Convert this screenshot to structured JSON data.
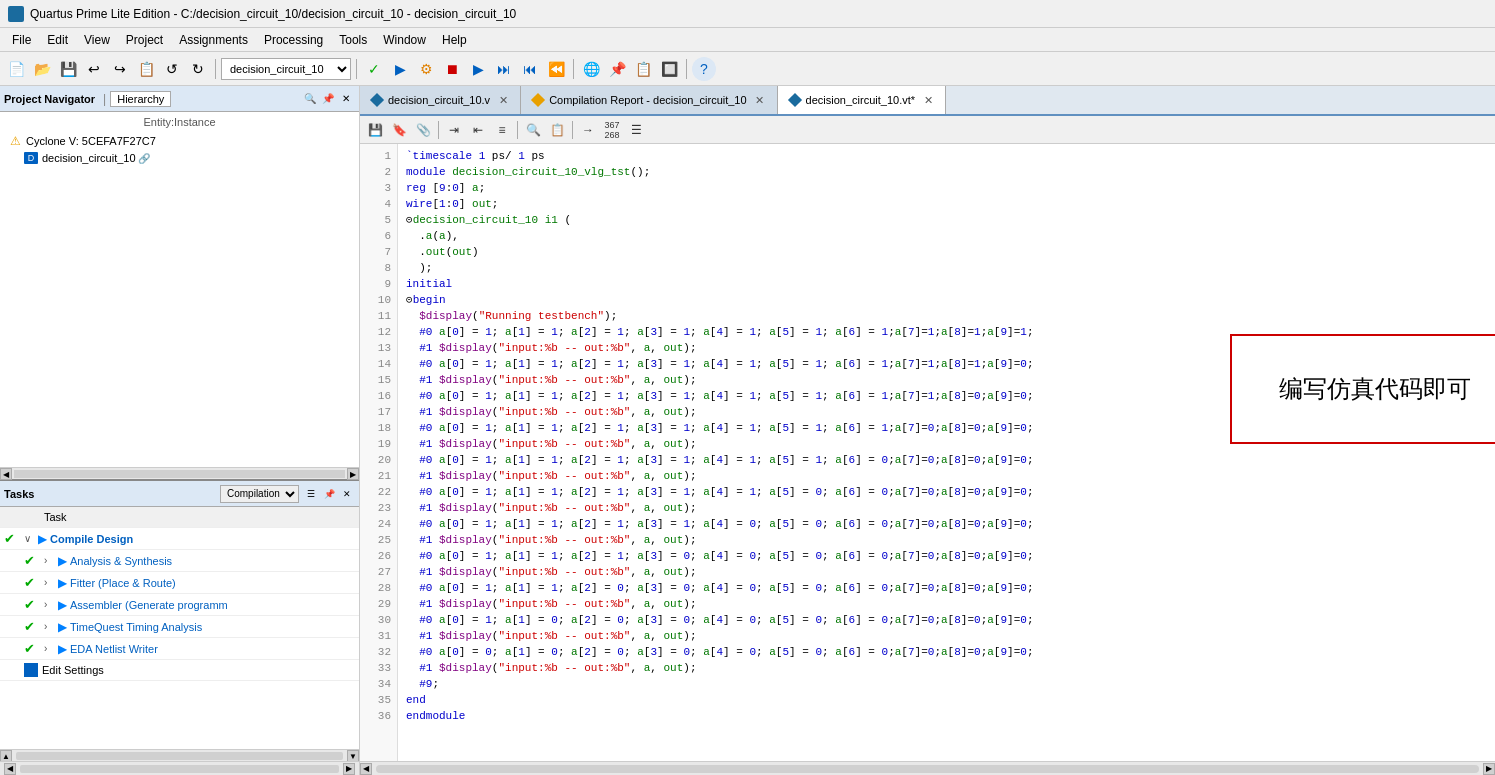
{
  "titleBar": {
    "title": "Quartus Prime Lite Edition - C:/decision_circuit_10/decision_circuit_10 - decision_circuit_10"
  },
  "menuBar": {
    "items": [
      "File",
      "Edit",
      "View",
      "Project",
      "Assignments",
      "Processing",
      "Tools",
      "Window",
      "Help"
    ]
  },
  "toolbar": {
    "projectDropdown": "decision_circuit_10"
  },
  "projectNav": {
    "title": "Project Navigator",
    "tab": "Hierarchy",
    "entityLabel": "Entity:Instance",
    "cycloneItem": "Cyclone V: 5CEFA7F27C7",
    "designItem": "decision_circuit_10"
  },
  "tasksPanel": {
    "title": "Tasks",
    "dropdown": "Compilation",
    "headerLabel": "Task",
    "tasks": [
      {
        "check": true,
        "expand": true,
        "play": true,
        "text": "Compile Design",
        "indent": 1
      },
      {
        "check": true,
        "expand": true,
        "play": true,
        "text": "Analysis & Synthesis",
        "indent": 2
      },
      {
        "check": true,
        "expand": true,
        "play": true,
        "text": "Fitter (Place & Route)",
        "indent": 2
      },
      {
        "check": true,
        "expand": true,
        "play": true,
        "text": "Assembler (Generate programm",
        "indent": 2
      },
      {
        "check": true,
        "expand": true,
        "play": true,
        "text": "TimeQuest Timing Analysis",
        "indent": 2
      },
      {
        "check": true,
        "expand": true,
        "play": true,
        "text": "EDA Netlist Writer",
        "indent": 2
      }
    ],
    "editSettings": "Edit Settings"
  },
  "tabs": [
    {
      "label": "decision_circuit_10.v",
      "active": false,
      "closeable": true,
      "iconType": "diamond-blue"
    },
    {
      "label": "Compilation Report - decision_circuit_10",
      "active": false,
      "closeable": true,
      "iconType": "diamond-yellow"
    },
    {
      "label": "decision_circuit_10.vt*",
      "active": true,
      "closeable": true,
      "iconType": "diamond-blue"
    }
  ],
  "annotation": {
    "text": "编写仿真代码即可"
  },
  "code": {
    "lines": [
      {
        "num": 1,
        "content": "    `timescale 1 ps/ 1 ps"
      },
      {
        "num": 2,
        "content": "    module decision_circuit_10_vlg_tst();"
      },
      {
        "num": 3,
        "content": "    reg [9:0] a;"
      },
      {
        "num": 4,
        "content": "    wire[1:0] out;"
      },
      {
        "num": 5,
        "content": "  ⊟decision_circuit_10 i1 ("
      },
      {
        "num": 6,
        "content": "    .a(a),"
      },
      {
        "num": 7,
        "content": "    .out(out)"
      },
      {
        "num": 8,
        "content": "    );"
      },
      {
        "num": 9,
        "content": "    initial"
      },
      {
        "num": 10,
        "content": "  ⊟begin"
      },
      {
        "num": 11,
        "content": "    $display(\"Running testbench\");"
      },
      {
        "num": 12,
        "content": "    #0 a[0] = 1; a[1] = 1; a[2] = 1; a[3] = 1; a[4] = 1; a[5] = 1; a[6] = 1;a[7]=1;a[8]=1;a[9]=1;"
      },
      {
        "num": 13,
        "content": "    #1 $display(\"input:%b -- out:%b\", a, out);"
      },
      {
        "num": 14,
        "content": "    #0 a[0] = 1; a[1] = 1; a[2] = 1; a[3] = 1; a[4] = 1; a[5] = 1; a[6] = 1;a[7]=1;a[8]=1;a[9]=0;"
      },
      {
        "num": 15,
        "content": "    #1 $display(\"input:%b -- out:%b\", a, out);"
      },
      {
        "num": 16,
        "content": "    #0 a[0] = 1; a[1] = 1; a[2] = 1; a[3] = 1; a[4] = 1; a[5] = 1; a[6] = 1;a[7]=1;a[8]=0;a[9]=0;"
      },
      {
        "num": 17,
        "content": "    #1 $display(\"input:%b -- out:%b\", a, out);"
      },
      {
        "num": 18,
        "content": "    #0 a[0] = 1; a[1] = 1; a[2] = 1; a[3] = 1; a[4] = 1; a[5] = 1; a[6] = 1;a[7]=0;a[8]=0;a[9]=0;"
      },
      {
        "num": 19,
        "content": "    #1 $display(\"input:%b -- out:%b\", a, out);"
      },
      {
        "num": 20,
        "content": "    #0 a[0] = 1; a[1] = 1; a[2] = 1; a[3] = 1; a[4] = 1; a[5] = 1; a[6] = 0;a[7]=0;a[8]=0;a[9]=0;"
      },
      {
        "num": 21,
        "content": "    #1 $display(\"input:%b -- out:%b\", a, out);"
      },
      {
        "num": 22,
        "content": "    #0 a[0] = 1; a[1] = 1; a[2] = 1; a[3] = 1; a[4] = 1; a[5] = 0; a[6] = 0;a[7]=0;a[8]=0;a[9]=0;"
      },
      {
        "num": 23,
        "content": "    #1 $display(\"input:%b -- out:%b\", a, out);"
      },
      {
        "num": 24,
        "content": "    #0 a[0] = 1; a[1] = 1; a[2] = 1; a[3] = 1; a[4] = 0; a[5] = 0; a[6] = 0;a[7]=0;a[8]=0;a[9]=0;"
      },
      {
        "num": 25,
        "content": "    #1 $display(\"input:%b -- out:%b\", a, out);"
      },
      {
        "num": 26,
        "content": "    #0 a[0] = 1; a[1] = 1; a[2] = 1; a[3] = 0; a[4] = 0; a[5] = 0; a[6] = 0;a[7]=0;a[8]=0;a[9]=0;"
      },
      {
        "num": 27,
        "content": "    #1 $display(\"input:%b -- out:%b\", a, out);"
      },
      {
        "num": 28,
        "content": "    #0 a[0] = 1; a[1] = 1; a[2] = 0; a[3] = 0; a[4] = 0; a[5] = 0; a[6] = 0;a[7]=0;a[8]=0;a[9]=0;"
      },
      {
        "num": 29,
        "content": "    #1 $display(\"input:%b -- out:%b\", a, out);"
      },
      {
        "num": 30,
        "content": "    #0 a[0] = 1; a[1] = 0; a[2] = 0; a[3] = 0; a[4] = 0; a[5] = 0; a[6] = 0;a[7]=0;a[8]=0;a[9]=0;"
      },
      {
        "num": 31,
        "content": "    #1 $display(\"input:%b -- out:%b\", a, out);"
      },
      {
        "num": 32,
        "content": "    #0 a[0] = 0; a[1] = 0; a[2] = 0; a[3] = 0; a[4] = 0; a[5] = 0; a[6] = 0;a[7]=0;a[8]=0;a[9]=0;"
      },
      {
        "num": 33,
        "content": "    #1 $display(\"input:%b -- out:%b\", a, out);"
      },
      {
        "num": 34,
        "content": "    #9;"
      },
      {
        "num": 35,
        "content": "  ⊟end"
      },
      {
        "num": 36,
        "content": "  endmodule"
      }
    ]
  }
}
